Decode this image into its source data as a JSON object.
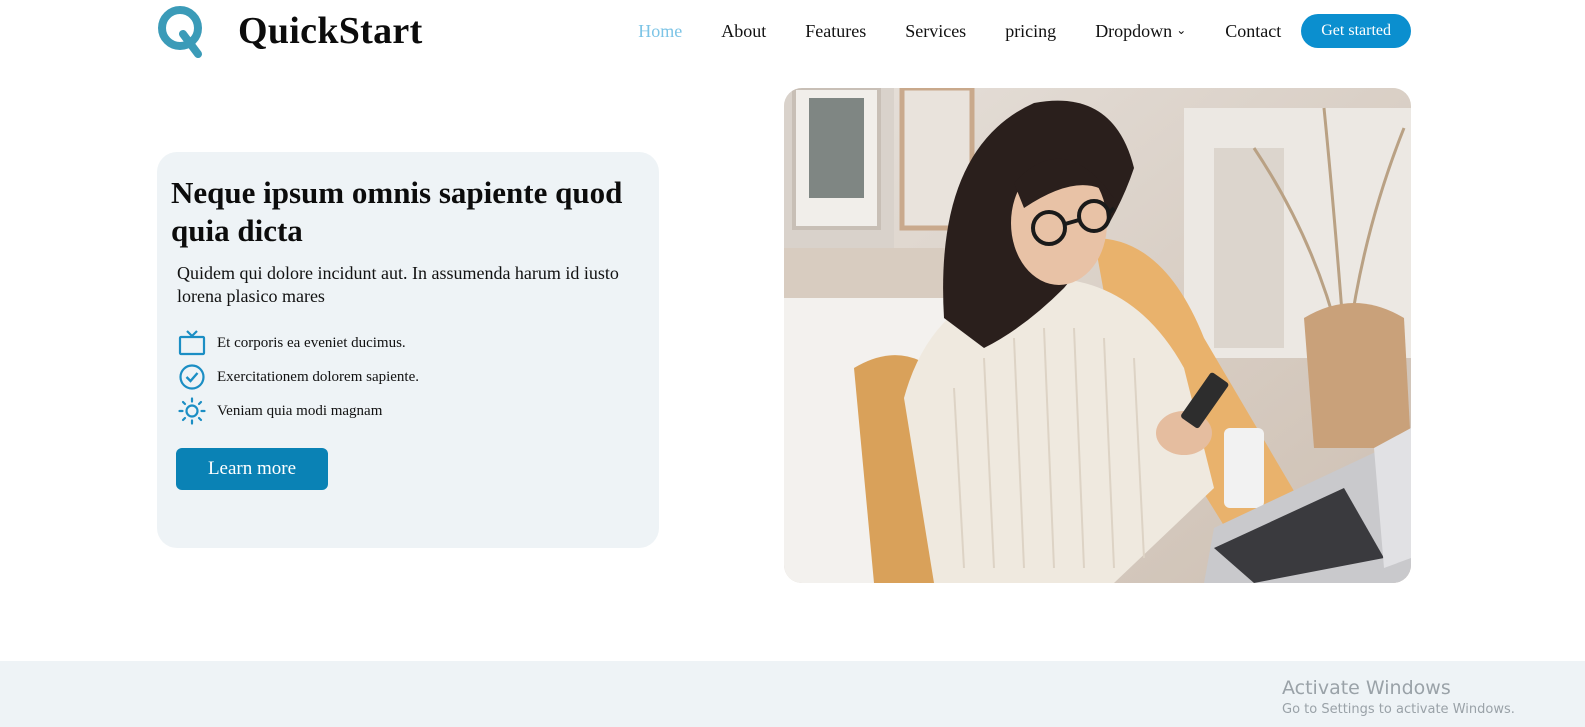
{
  "brand": {
    "name": "QuickStart"
  },
  "nav": {
    "items": [
      {
        "label": "Home",
        "active": true
      },
      {
        "label": "About"
      },
      {
        "label": "Features"
      },
      {
        "label": "Services"
      },
      {
        "label": "pricing"
      },
      {
        "label": "Dropdown"
      },
      {
        "label": "Contact"
      }
    ],
    "cta": "Get started"
  },
  "hero": {
    "title": "Neque ipsum omnis sapiente quod quia dicta",
    "lead": "Quidem qui dolore incidunt aut. In assumenda harum id iusto lorena plasico mares",
    "features": [
      {
        "icon": "tv-icon",
        "text": "Et corporis ea eveniet ducimus."
      },
      {
        "icon": "check-circle-icon",
        "text": "Exercitationem dolorem sapiente."
      },
      {
        "icon": "sun-icon",
        "text": "Veniam quia modi magnam"
      }
    ],
    "button": "Learn more"
  },
  "watermark": {
    "line1": "Activate Windows",
    "line2": "Go to Settings to activate Windows."
  },
  "colors": {
    "accent": "#0b8fcf",
    "active_nav": "#7cc4e6",
    "card_bg": "#eef3f6",
    "button": "#0a82b5"
  }
}
